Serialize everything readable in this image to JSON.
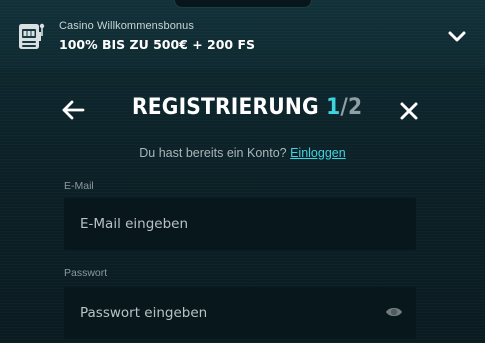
{
  "banner": {
    "subtitle": "Casino Willkommensbonus",
    "title": "100% BIS ZU 500€ + 200 FS",
    "icon": "slot-machine-icon",
    "toggle_icon": "chevron-down-icon"
  },
  "registration": {
    "title": "REGISTRIERUNG",
    "step_current": "1",
    "step_separator": "/",
    "step_total": "2",
    "back_icon": "arrow-left-icon",
    "close_icon": "close-icon",
    "account_prompt": "Du hast bereits ein Konto?",
    "login_link": "Einloggen"
  },
  "form": {
    "email": {
      "label": "E-Mail",
      "placeholder": "E-Mail eingeben",
      "value": ""
    },
    "password": {
      "label": "Passwort",
      "placeholder": "Passwort eingeben",
      "value": "",
      "toggle_icon": "eye-icon"
    }
  },
  "colors": {
    "background": "#0c2127",
    "banner_background": "#123139",
    "accent": "#3fd3e0",
    "field_background": "#08171b",
    "muted_text": "#aab6b9"
  }
}
